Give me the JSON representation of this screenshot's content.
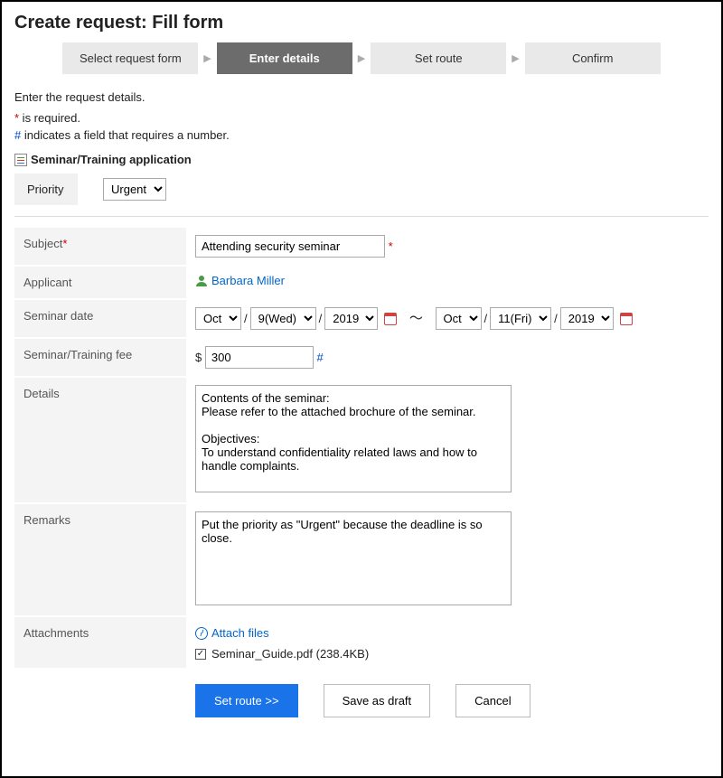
{
  "page_title": "Create request: Fill form",
  "stepper": {
    "steps": [
      "Select request form",
      "Enter details",
      "Set route",
      "Confirm"
    ],
    "active_index": 1
  },
  "intro": "Enter the request details.",
  "required_line": " is required.",
  "number_line": " indicates a field that requires a number.",
  "section_title": "Seminar/Training application",
  "priority": {
    "label": "Priority",
    "value": "Urgent"
  },
  "fields": {
    "subject": {
      "label": "Subject",
      "value": "Attending security seminar"
    },
    "applicant": {
      "label": "Applicant",
      "name": "Barbara Miller"
    },
    "seminar_date": {
      "label": "Seminar date",
      "from": {
        "month": "Oct",
        "day": "9(Wed)",
        "year": "2019"
      },
      "to": {
        "month": "Oct",
        "day": "11(Fri)",
        "year": "2019"
      }
    },
    "fee": {
      "label": "Seminar/Training fee",
      "currency": "$",
      "value": "300"
    },
    "details": {
      "label": "Details",
      "value": "Contents of the seminar:\nPlease refer to the attached brochure of the seminar.\n\nObjectives:\nTo understand confidentiality related laws and how to handle complaints."
    },
    "remarks": {
      "label": "Remarks",
      "value": "Put the priority as \"Urgent\" because the deadline is so close."
    },
    "attachments": {
      "label": "Attachments",
      "link_text": "Attach files",
      "file": "Seminar_Guide.pdf (238.4KB)"
    }
  },
  "buttons": {
    "set_route": "Set route >>",
    "save_draft": "Save as draft",
    "cancel": "Cancel"
  }
}
